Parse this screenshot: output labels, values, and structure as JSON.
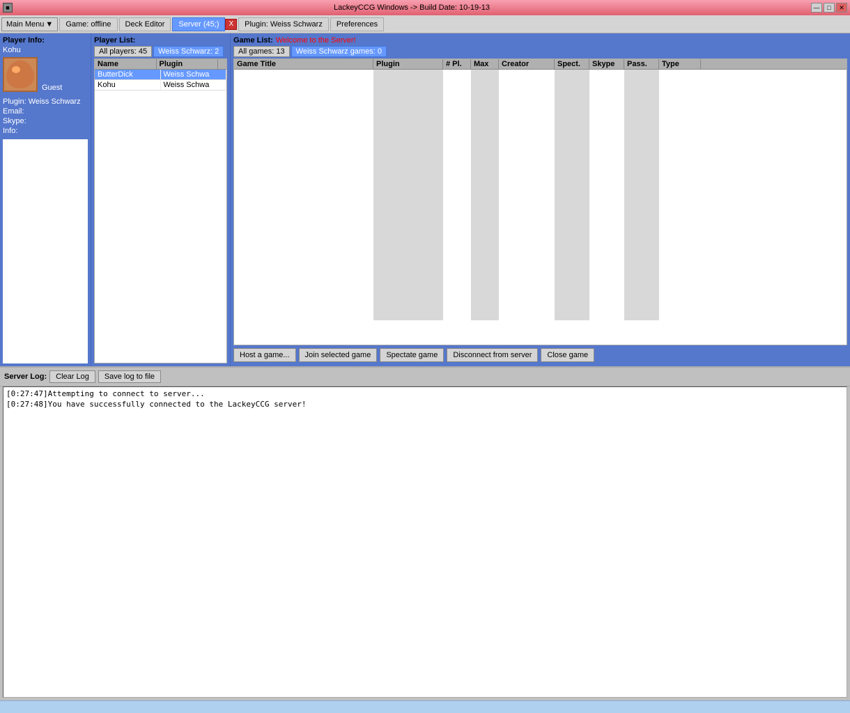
{
  "window": {
    "title": "LackeyCCG Windows -> Build Date: 10-19-13",
    "icon": "app-icon"
  },
  "titlebar_controls": {
    "minimize": "—",
    "maximize": "□",
    "close": "✕"
  },
  "menubar": {
    "main_menu": "Main Menu",
    "main_menu_arrow": "▼",
    "game_offline": "Game: offline",
    "deck_editor": "Deck Editor",
    "server": "Server (45;)",
    "close_server": "X",
    "plugin": "Plugin: Weiss Schwarz",
    "preferences": "Preferences"
  },
  "player_info": {
    "label": "Player Info:",
    "name": "Kohu",
    "guest_label": "Guest",
    "plugin_label": "Plugin: Weiss Schwarz",
    "email_label": "Email:",
    "skype_label": "Skype:",
    "info_label": "Info:"
  },
  "player_list": {
    "label": "Player List:",
    "filter_all": "All players: 45",
    "filter_plugin": "Weiss Schwarz: 2",
    "columns": [
      "Name",
      "Plugin"
    ],
    "players": [
      {
        "name": "ButterDick",
        "plugin": "Weiss Schwa"
      },
      {
        "name": "Kohu",
        "plugin": "Weiss Schwa"
      }
    ]
  },
  "game_list": {
    "label": "Game List:",
    "welcome": "Welcome to the Server!",
    "filter_all": "All games: 13",
    "filter_plugin": "Weiss Schwarz games: 0",
    "columns": [
      "Game Title",
      "Plugin",
      "# Pl.",
      "Max",
      "Creator",
      "Spect.",
      "Skype",
      "Pass.",
      "Type"
    ],
    "games": []
  },
  "game_actions": {
    "host": "Host a game...",
    "join": "Join selected game",
    "spectate": "Spectate game",
    "disconnect": "Disconnect from server",
    "close": "Close game"
  },
  "server_log": {
    "label": "Server Log:",
    "clear_btn": "Clear Log",
    "save_btn": "Save log to file",
    "entries": [
      "[0:27:47]Attempting to connect to server...",
      "[0:27:48]You have successfully connected to the LackeyCCG server!"
    ]
  },
  "statusbar": {
    "text": ""
  }
}
